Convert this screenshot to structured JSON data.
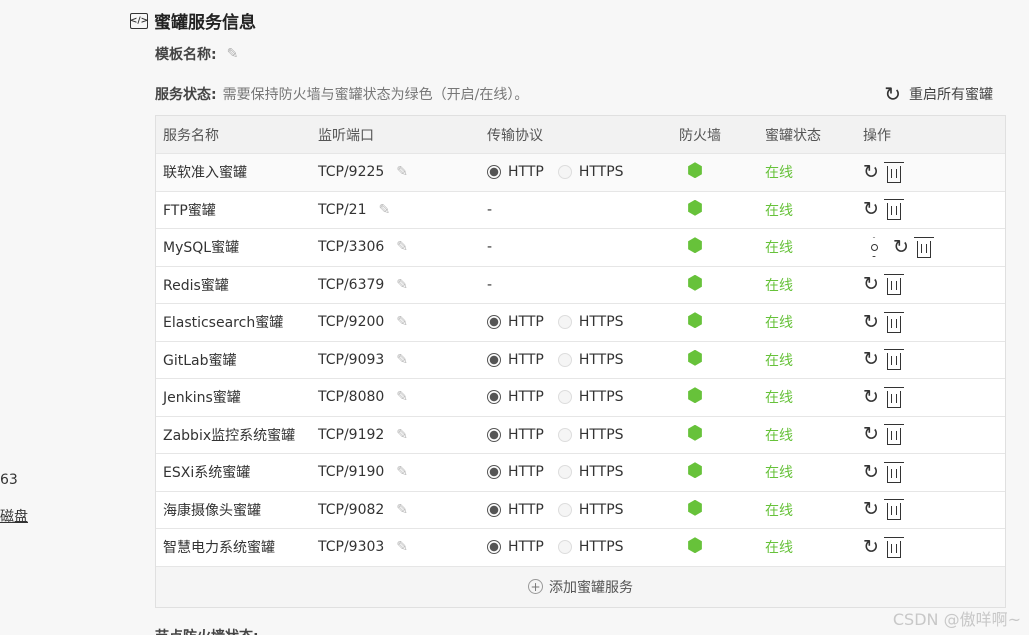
{
  "left": {
    "num": "63",
    "disk": "磁盘"
  },
  "section": {
    "title": "蜜罐服务信息"
  },
  "meta": {
    "template_label": "模板名称:",
    "status_label": "服务状态:",
    "status_desc": "需要保持防火墙与蜜罐状态为绿色（开启/在线）。"
  },
  "restart_all": "重启所有蜜罐",
  "table": {
    "headers": [
      "服务名称",
      "监听端口",
      "传输协议",
      "防火墙",
      "蜜罐状态",
      "操作"
    ],
    "rows": [
      {
        "name": "联软准入蜜罐",
        "port": "TCP/9225",
        "protocol": [
          "HTTP",
          "HTTPS"
        ],
        "status": "在线"
      },
      {
        "name": "FTP蜜罐",
        "port": "TCP/21",
        "protocol_text": "-",
        "status": "在线"
      },
      {
        "name": "MySQL蜜罐",
        "port": "TCP/3306",
        "protocol_text": "-",
        "status": "在线"
      },
      {
        "name": "Redis蜜罐",
        "port": "TCP/6379",
        "protocol_text": "-",
        "status": "在线"
      },
      {
        "name": "Elasticsearch蜜罐",
        "port": "TCP/9200",
        "protocol": [
          "HTTP",
          "HTTPS"
        ],
        "status": "在线"
      },
      {
        "name": "GitLab蜜罐",
        "port": "TCP/9093",
        "protocol": [
          "HTTP",
          "HTTPS"
        ],
        "status": "在线"
      },
      {
        "name": "Jenkins蜜罐",
        "port": "TCP/8080",
        "protocol": [
          "HTTP",
          "HTTPS"
        ],
        "status": "在线"
      },
      {
        "name": "Zabbix监控系统蜜罐",
        "port": "TCP/9192",
        "protocol": [
          "HTTP",
          "HTTPS"
        ],
        "status": "在线"
      },
      {
        "name": "ESXi系统蜜罐",
        "port": "TCP/9190",
        "protocol": [
          "HTTP",
          "HTTPS"
        ],
        "status": "在线"
      },
      {
        "name": "海康摄像头蜜罐",
        "port": "TCP/9082",
        "protocol": [
          "HTTP",
          "HTTPS"
        ],
        "status": "在线"
      },
      {
        "name": "智慧电力系统蜜罐",
        "port": "TCP/9303",
        "protocol": [
          "HTTP",
          "HTTPS"
        ],
        "status": "在线"
      }
    ]
  },
  "add_service": "添加蜜罐服务",
  "watermark": "CSDN @傲咩啊~",
  "next_section": "节点防火墙状态:",
  "colors": {
    "online": "#67c23a",
    "firewall": "#67c23a"
  }
}
